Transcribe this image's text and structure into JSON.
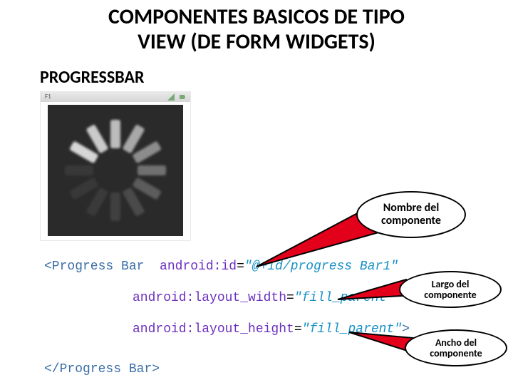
{
  "title_line1": "COMPONENTES  BASICOS DE TIPO",
  "title_line2": "VIEW (DE  FORM  WIDGETS)",
  "subtitle": "PROGRESSBAR",
  "emulator": {
    "label": "F1"
  },
  "code": {
    "open_tag": "<Progress Bar",
    "attr_id_name": "android:id",
    "attr_id_value": "\"@+id/progress Bar1\"",
    "attr_w_name": "android:layout_width",
    "attr_w_value": "\"fill_parent\"",
    "attr_h_name": "android:layout_height",
    "attr_h_value": "\"fill_parent\"",
    "close_tag": "</Progress Bar>"
  },
  "callouts": {
    "c1_l1": "Nombre del",
    "c1_l2": "componente",
    "c2_l1": "Largo del",
    "c2_l2": "componente",
    "c3_l1": "Ancho del",
    "c3_l2": "componente"
  },
  "colors": {
    "tail_fill": "#e2001a"
  }
}
